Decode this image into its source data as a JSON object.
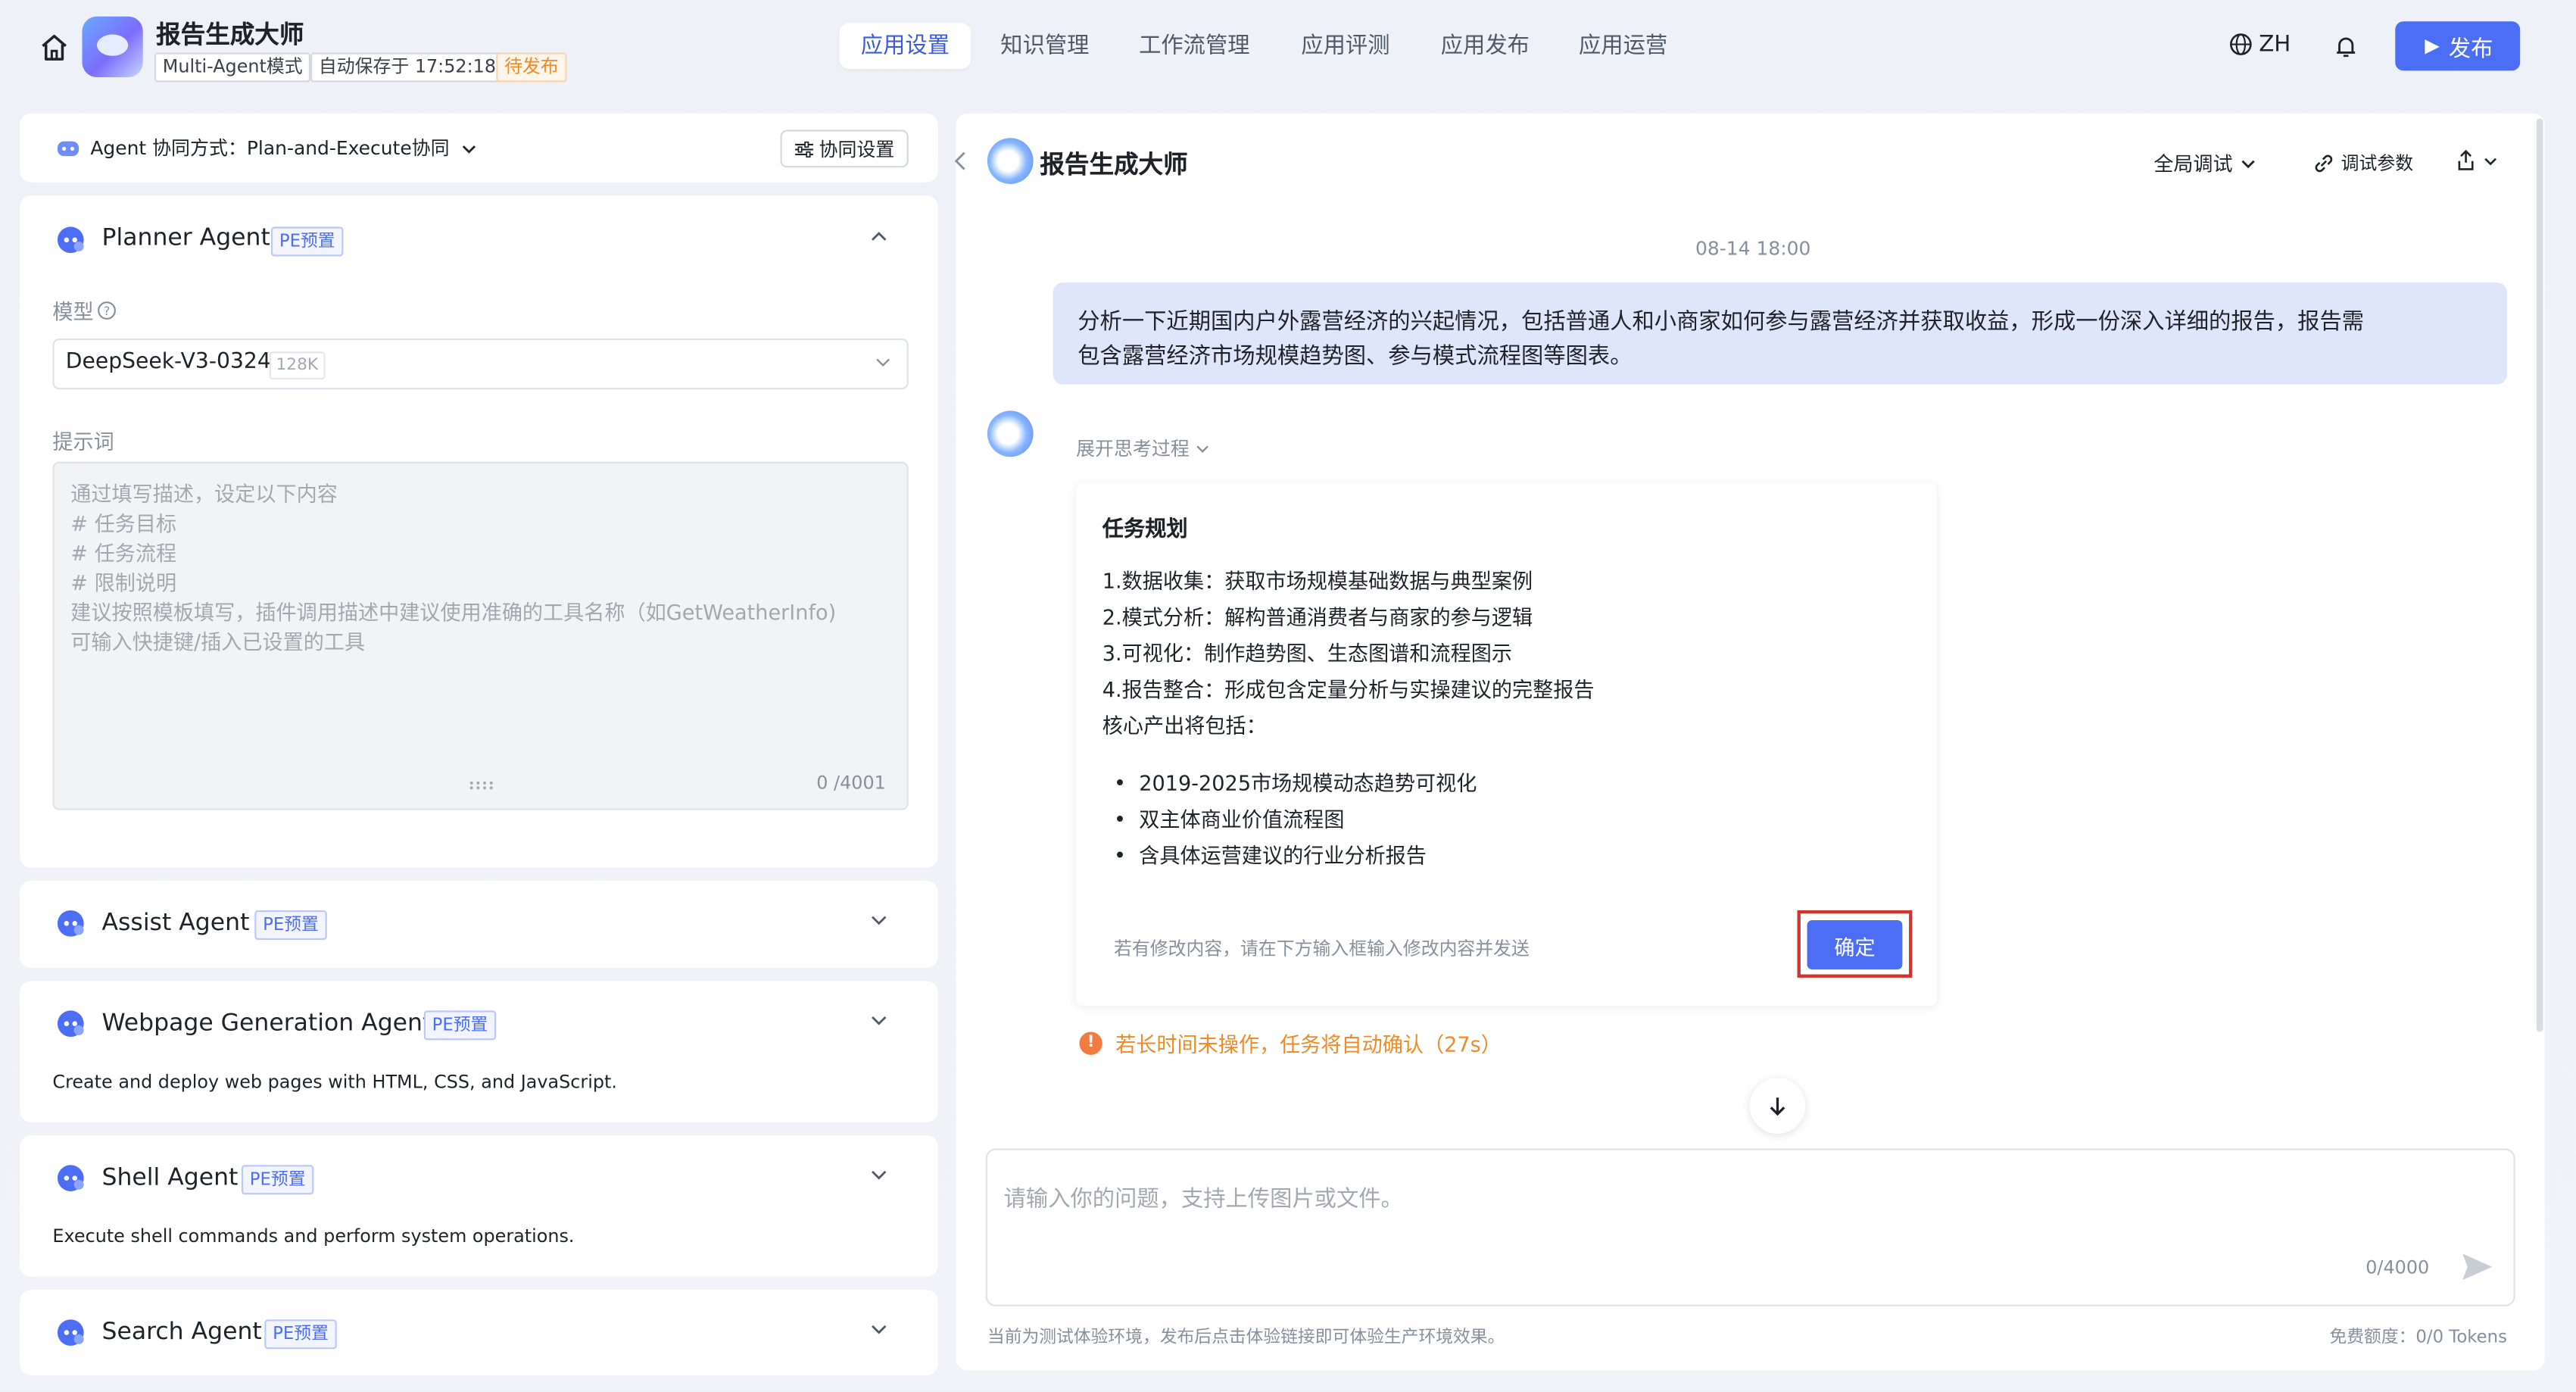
{
  "header": {
    "title": "报告生成大师",
    "mode_tag": "Multi-Agent模式",
    "autosave": "自动保存于 17:52:18",
    "status_tag": "待发布",
    "tabs": [
      "应用设置",
      "知识管理",
      "工作流管理",
      "应用评测",
      "应用发布",
      "应用运营"
    ],
    "language": "ZH",
    "publish_label": "发布"
  },
  "left": {
    "collab_mode": "Agent 协同方式：Plan-and-Execute协同",
    "collab_settings": "协同设置",
    "planner": {
      "name": "Planner Agent",
      "tag": "PE预置",
      "model_label": "模型",
      "model_value": "DeepSeek-V3-0324",
      "model_context": "128K",
      "prompt_label": "提示词",
      "prompt_placeholder": [
        "通过填写描述，设定以下内容",
        "# 任务目标",
        "# 任务流程",
        "# 限制说明",
        "建议按照模板填写，插件调用描述中建议使用准确的工具名称（如GetWeatherInfo)",
        "可输入快捷键/插入已设置的工具"
      ],
      "prompt_count": "0 /4001"
    },
    "agents": [
      {
        "name": "Assist Agent",
        "tag": "PE预置",
        "desc": ""
      },
      {
        "name": "Webpage Generation Agent",
        "tag": "PE预置",
        "desc": "Create and deploy web pages with HTML, CSS, and JavaScript."
      },
      {
        "name": "Shell Agent",
        "tag": "PE预置",
        "desc": "Execute shell commands and perform system operations."
      },
      {
        "name": "Search Agent",
        "tag": "PE预置",
        "desc": ""
      }
    ]
  },
  "right": {
    "title": "报告生成大师",
    "debug_scope": "全局调试",
    "debug_params": "调试参数",
    "timestamp": "08-14 18:00",
    "user_message": [
      "分析一下近期国内户外露营经济的兴起情况，包括普通人和小商家如何参与露营经济并获取收益，形成一份深入详细的报告，报告需",
      "包含露营经济市场规模趋势图、参与模式流程图等图表。"
    ],
    "think_toggle": "展开思考过程",
    "plan": {
      "title": "任务规划",
      "steps": [
        "1.数据收集：获取市场规模基础数据与典型案例",
        "2.模式分析：解构普通消费者与商家的参与逻辑",
        "3.可视化：制作趋势图、生态图谱和流程图示",
        "4.报告整合：形成包含定量分析与实操建议的完整报告"
      ],
      "outputs_label": "核心产出将包括：",
      "outputs": [
        "2019-2025市场规模动态趋势可视化",
        "双主体商业价值流程图",
        "含具体运营建议的行业分析报告"
      ],
      "hint": "若有修改内容，请在下方输入框输入修改内容并发送",
      "confirm_label": "确定"
    },
    "auto_confirm_warning": "若长时间未操作，任务将自动确认（27s）",
    "input_placeholder": "请输入你的问题，支持上传图片或文件。",
    "input_count": "0/4000",
    "footer_note": "当前为测试体验环境，发布后点击体验链接即可体验生产环境效果。",
    "quota": "免费额度：0/0 Tokens"
  },
  "colors": {
    "accent": "#4c6ef5",
    "warning": "#f08a24",
    "highlight": "#d0342c"
  }
}
